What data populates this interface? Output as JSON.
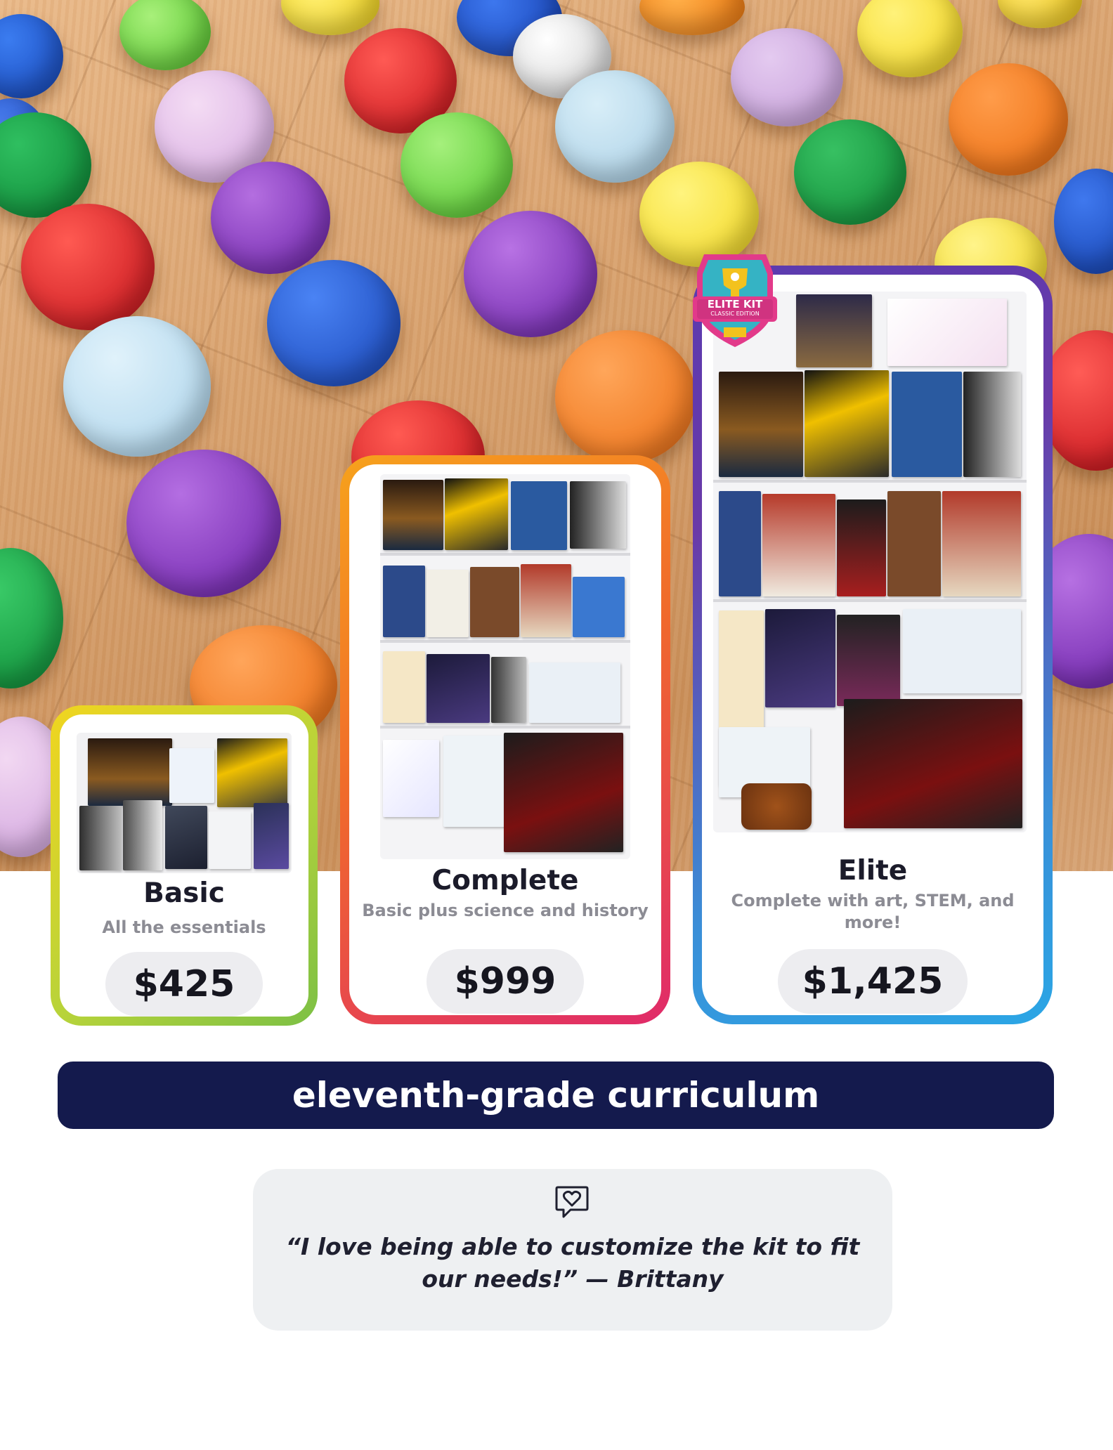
{
  "page": {
    "banner_title": "eleventh-grade curriculum"
  },
  "badge": {
    "line1": "ELITE KIT",
    "line2": "CLASSIC EDITION"
  },
  "kits": [
    {
      "name": "Basic",
      "subtitle": "All the essentials",
      "price": "$425",
      "border_colors": [
        "#f1d51f",
        "#7cc045"
      ]
    },
    {
      "name": "Complete",
      "subtitle": "Basic plus science and history",
      "price": "$999",
      "border_colors": [
        "#f7a21c",
        "#e02a6a"
      ]
    },
    {
      "name": "Elite",
      "subtitle": "Complete with art, STEM, and more!",
      "price": "$1,425",
      "border_colors": [
        "#5a3bb0",
        "#2ba6e5"
      ]
    }
  ],
  "testimonial": {
    "icon": "heart-chat-icon",
    "quote": "“I love being able to customize the kit to fit our needs!” — Brittany"
  },
  "colors": {
    "banner_bg": "#141a4d",
    "price_pill_bg": "#ededf0",
    "quote_bg": "#eef0f2"
  }
}
